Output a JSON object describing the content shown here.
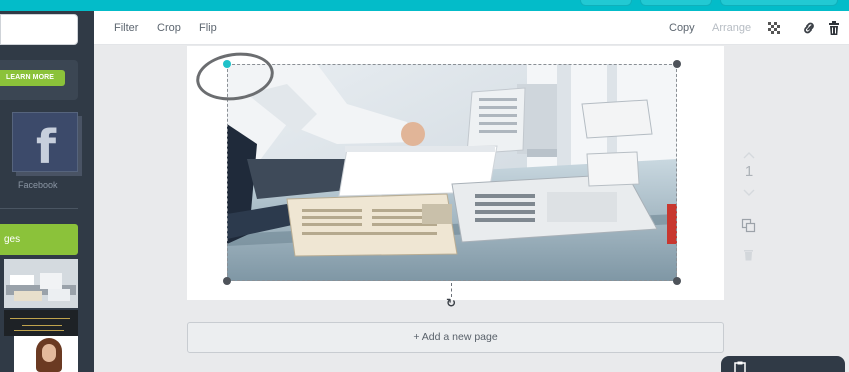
{
  "toolbar": {
    "filter_label": "Filter",
    "crop_label": "Crop",
    "flip_label": "Flip",
    "copy_label": "Copy",
    "arrange_label": "Arrange",
    "transparency_icon": "checkerboard-icon",
    "link_icon": "link-icon",
    "delete_icon": "trash-icon"
  },
  "sidebar": {
    "learn_more_label": "LEARN MORE",
    "facebook_label": "Facebook",
    "images_tab_label": "ges"
  },
  "page": {
    "number": "1",
    "add_page_label": "+ Add a new page"
  },
  "colors": {
    "accent_teal": "#03bcc9",
    "accent_green": "#8bc23a",
    "sidebar_dark": "#303a46"
  }
}
